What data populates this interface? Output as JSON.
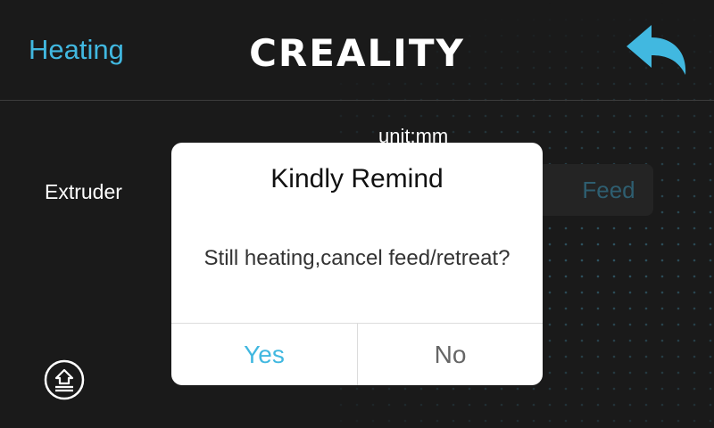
{
  "header": {
    "title": "Heating",
    "logo_text": "CREALITY",
    "back_icon": "back-arrow-icon"
  },
  "main": {
    "unit_label": "unit:mm",
    "extruder_label": "Extruder",
    "feed_label": "Feed",
    "home_icon": "home-icon"
  },
  "dialog": {
    "title": "Kindly Remind",
    "message": "Still heating,cancel feed/retreat?",
    "yes_label": "Yes",
    "no_label": "No"
  },
  "colors": {
    "accent": "#41b8e0",
    "background": "#1a1a1a",
    "dialog_bg": "#ffffff"
  }
}
